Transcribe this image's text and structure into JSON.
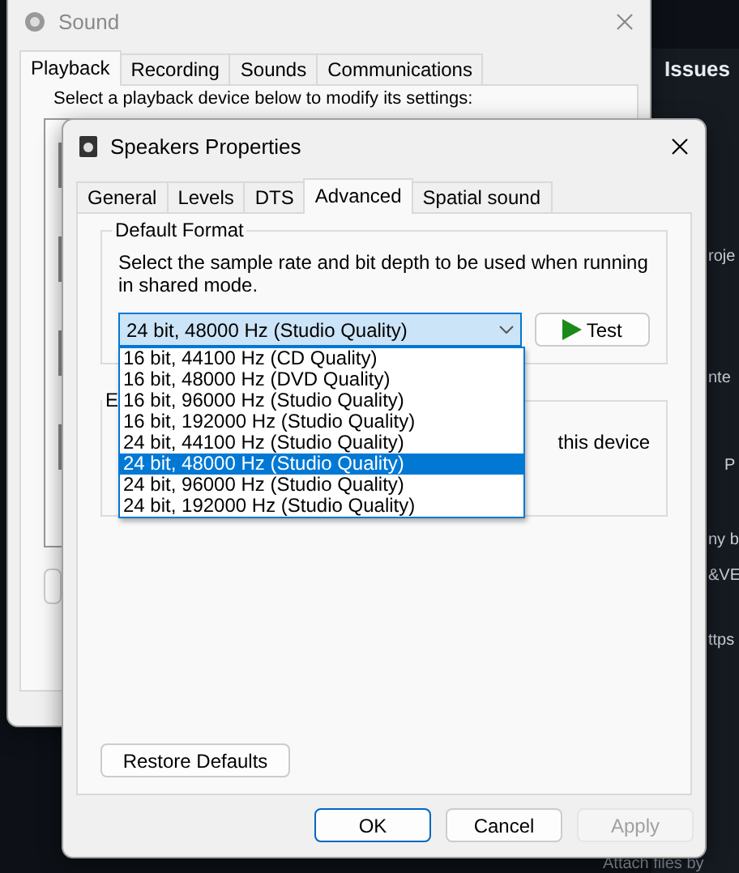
{
  "background": {
    "heading": "Issues",
    "fragments": [
      {
        "text": "roje"
      },
      {
        "text": "nte"
      },
      {
        "text": "P"
      },
      {
        "text": "ny b"
      },
      {
        "text": "&VE"
      },
      {
        "text": "ttps"
      }
    ],
    "footer": "Attach files by"
  },
  "sound_window": {
    "title": "Sound",
    "tabs": [
      {
        "label": "Playback",
        "selected": true
      },
      {
        "label": "Recording",
        "selected": false
      },
      {
        "label": "Sounds",
        "selected": false
      },
      {
        "label": "Communications",
        "selected": false
      }
    ],
    "instruction": "Select a playback device below to modify its settings:"
  },
  "properties_window": {
    "title": "Speakers Properties",
    "tabs": [
      {
        "label": "General",
        "selected": false
      },
      {
        "label": "Levels",
        "selected": false
      },
      {
        "label": "DTS",
        "selected": false
      },
      {
        "label": "Advanced",
        "selected": true
      },
      {
        "label": "Spatial sound",
        "selected": false
      }
    ],
    "default_format": {
      "title": "Default Format",
      "description": "Select the sample rate and bit depth to be used when running in shared mode.",
      "value": "24 bit, 48000 Hz (Studio Quality)",
      "expanded": true,
      "options": [
        {
          "label": "16 bit, 44100 Hz (CD Quality)",
          "selected": false
        },
        {
          "label": "16 bit, 48000 Hz (DVD Quality)",
          "selected": false
        },
        {
          "label": "16 bit, 96000 Hz (Studio Quality)",
          "selected": false
        },
        {
          "label": "16 bit, 192000 Hz (Studio Quality)",
          "selected": false
        },
        {
          "label": "24 bit, 44100 Hz (Studio Quality)",
          "selected": false
        },
        {
          "label": "24 bit, 48000 Hz (Studio Quality)",
          "selected": true
        },
        {
          "label": "24 bit, 96000 Hz (Studio Quality)",
          "selected": false
        },
        {
          "label": "24 bit, 192000 Hz (Studio Quality)",
          "selected": false
        }
      ]
    },
    "test_button": "Test",
    "exclusive_mode": {
      "title": "E",
      "text": "this device"
    },
    "restore_button": "Restore Defaults",
    "buttons": [
      {
        "label": "OK",
        "default": true,
        "disabled": false
      },
      {
        "label": "Cancel",
        "default": false,
        "disabled": false
      },
      {
        "label": "Apply",
        "default": false,
        "disabled": true
      }
    ]
  }
}
